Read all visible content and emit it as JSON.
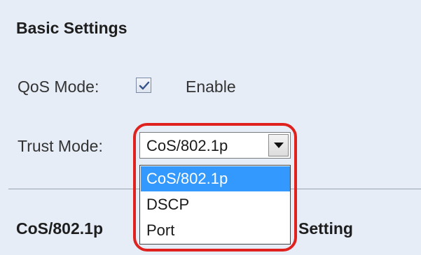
{
  "basic_settings": {
    "title": "Basic Settings",
    "qos_mode_label": "QoS Mode:",
    "qos_mode_checked": true,
    "qos_mode_option": "Enable",
    "trust_mode_label": "Trust Mode:",
    "trust_mode_value": "CoS/802.1p",
    "trust_mode_options": [
      "CoS/802.1p",
      "DSCP",
      "Port"
    ],
    "trust_mode_selected_index": 0
  },
  "next_section": {
    "title_start": "CoS/802.1p",
    "title_end": "Setting"
  },
  "colors": {
    "panel_background": "#e6edf7",
    "selected_option": "#3399ff",
    "highlight_outline": "#e0221f"
  },
  "icons": {
    "checkbox": "check-icon",
    "dropdown": "chevron-down-icon"
  }
}
